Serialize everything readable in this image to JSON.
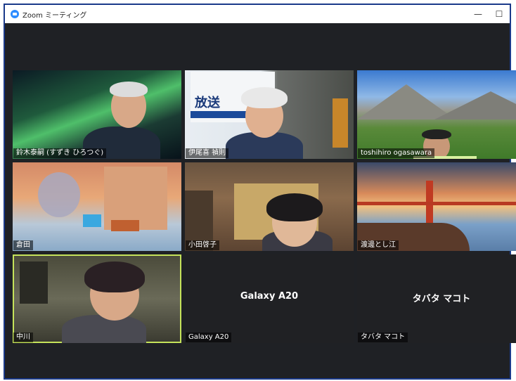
{
  "window": {
    "title": "Zoom ミーティング",
    "minimize": "—",
    "maximize": "☐"
  },
  "participants": [
    {
      "name": "鈴木泰嗣 (すずき ひろつぐ)"
    },
    {
      "name": "伊尾喜 禎則",
      "sign_text": "放送"
    },
    {
      "name": "toshihiro ogasawara"
    },
    {
      "name": "倉田"
    },
    {
      "name": "小田啓子"
    },
    {
      "name": "渡邊とし江"
    },
    {
      "name": "中川",
      "active": true
    },
    {
      "name": "Galaxy A20",
      "display": "Galaxy A20"
    },
    {
      "name": "タバタ マコト",
      "display": "タバタ マコト"
    }
  ],
  "colors": {
    "active_border": "#c5e35a",
    "frame_border": "#1a3a8a",
    "background": "#1f2125"
  }
}
